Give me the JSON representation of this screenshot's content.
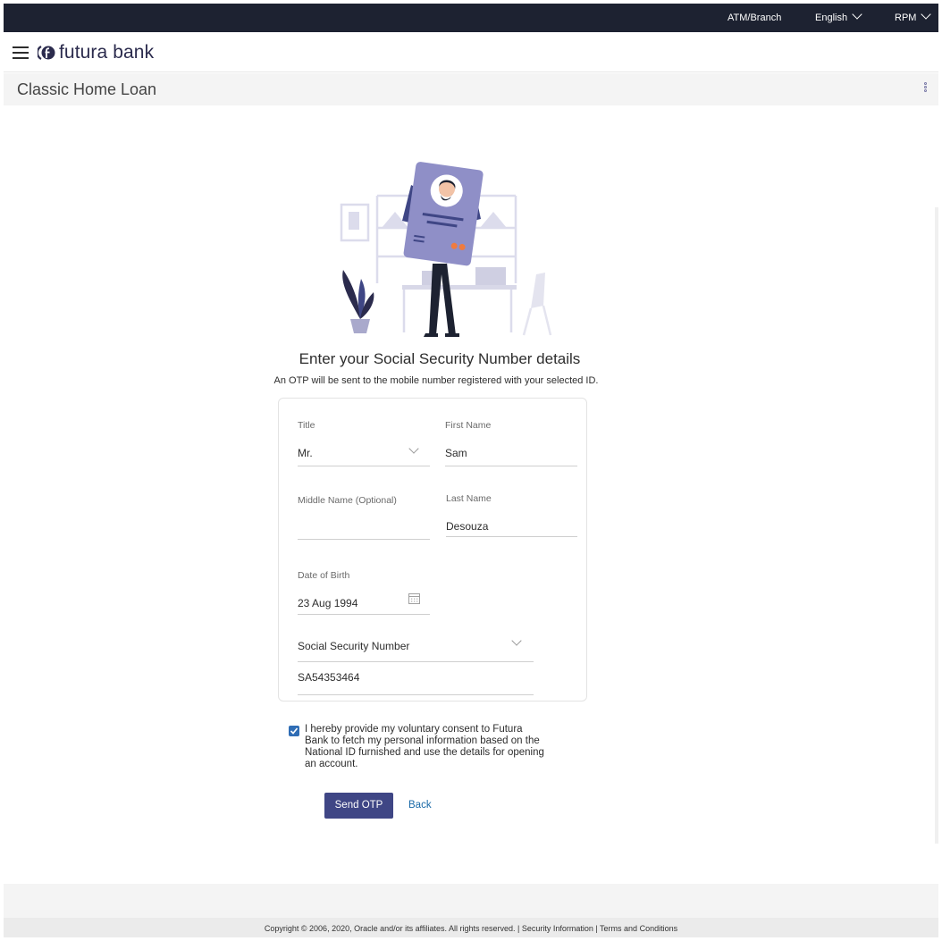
{
  "topbar": {
    "atm_branch": "ATM/Branch",
    "language": "English",
    "user": "RPM"
  },
  "header": {
    "logo_text": "futura bank"
  },
  "titlebar": {
    "title": "Classic Home Loan"
  },
  "main": {
    "heading": "Enter your Social Security Number details",
    "subheading": "An OTP will be sent to the mobile number registered with your selected ID."
  },
  "form": {
    "title": {
      "label": "Title",
      "value": "Mr."
    },
    "first_name": {
      "label": "First Name",
      "value": "Sam"
    },
    "middle_name": {
      "label": "Middle Name (Optional)",
      "value": ""
    },
    "last_name": {
      "label": "Last Name",
      "value": "Desouza"
    },
    "dob": {
      "label": "Date of Birth",
      "value": "23 Aug 1994"
    },
    "id_type": {
      "value": "Social Security Number"
    },
    "id_number": {
      "value": "SA54353464"
    }
  },
  "consent": {
    "checked": true,
    "text": "I hereby provide my voluntary consent to Futura Bank to fetch my personal information based on the National ID furnished and use the details for opening an account."
  },
  "actions": {
    "send_otp": "Send OTP",
    "back": "Back"
  },
  "footer": {
    "text": "Copyright © 2006, 2020, Oracle and/or its affiliates. All rights reserved. | Security Information | Terms and Conditions"
  },
  "colors": {
    "topbar": "#1d2231",
    "primary_button": "#3f4685",
    "link": "#1a6aa8",
    "illustration_card": "#8f8fc7",
    "accent_orange": "#f07b3f"
  },
  "icons": [
    "hamburger-icon",
    "futura-logo-icon",
    "kebab-menu-icon",
    "chevron-down-icon",
    "calendar-icon",
    "checkbox-checked-icon"
  ]
}
